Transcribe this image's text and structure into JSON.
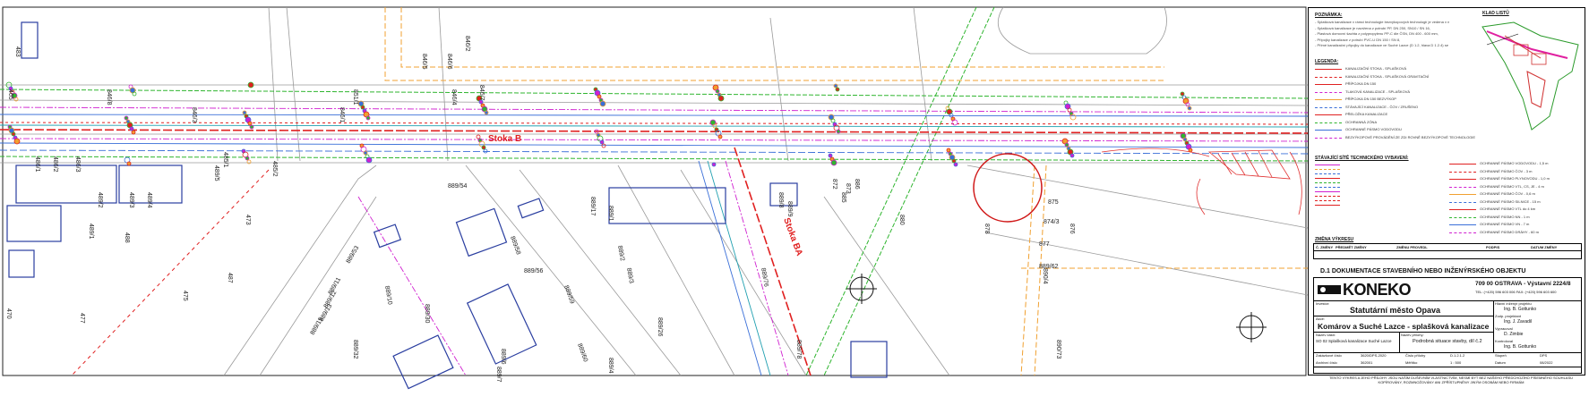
{
  "map": {
    "sewer_labels": [
      "Stoka B",
      "Stoka BA"
    ],
    "parcel_labels": [
      {
        "text": "846/5"
      },
      {
        "text": "846/6"
      },
      {
        "text": "846/7"
      },
      {
        "text": "846/4"
      },
      {
        "text": "846/8"
      },
      {
        "text": "846/3"
      },
      {
        "text": "846/1"
      },
      {
        "text": "489/5"
      },
      {
        "text": "489/4"
      },
      {
        "text": "489/3"
      },
      {
        "text": "489/2"
      },
      {
        "text": "489/1"
      },
      {
        "text": "486/3"
      },
      {
        "text": "486/2"
      },
      {
        "text": "486/1"
      },
      {
        "text": "485/1"
      },
      {
        "text": "485/2"
      },
      {
        "text": "488"
      },
      {
        "text": "487"
      },
      {
        "text": "473"
      },
      {
        "text": "475"
      },
      {
        "text": "477"
      },
      {
        "text": "470"
      },
      {
        "text": "483"
      },
      {
        "text": "465"
      },
      {
        "text": "889/54"
      },
      {
        "text": "889/53"
      },
      {
        "text": "889/56"
      },
      {
        "text": "889/58"
      },
      {
        "text": "889/59"
      },
      {
        "text": "889/60"
      },
      {
        "text": "889/17"
      },
      {
        "text": "889/26"
      },
      {
        "text": "889/30"
      },
      {
        "text": "889/32"
      },
      {
        "text": "889/10"
      },
      {
        "text": "889/11"
      },
      {
        "text": "889/12"
      },
      {
        "text": "889/13"
      },
      {
        "text": "889/15"
      },
      {
        "text": "889/1"
      },
      {
        "text": "889/2"
      },
      {
        "text": "889/3"
      },
      {
        "text": "889/4"
      },
      {
        "text": "889/6"
      },
      {
        "text": "889/7"
      },
      {
        "text": "889/76"
      },
      {
        "text": "889/78"
      },
      {
        "text": "889/8"
      },
      {
        "text": "889/9"
      },
      {
        "text": "889/62"
      },
      {
        "text": "890/4"
      },
      {
        "text": "890/73"
      },
      {
        "text": "874/3"
      },
      {
        "text": "877"
      },
      {
        "text": "875"
      },
      {
        "text": "876"
      },
      {
        "text": "878"
      },
      {
        "text": "880"
      },
      {
        "text": "885"
      },
      {
        "text": "886"
      },
      {
        "text": "851/1"
      },
      {
        "text": "846/2"
      },
      {
        "text": "872"
      },
      {
        "text": "873"
      }
    ]
  },
  "sheet": {
    "notes_title": "POZNÁMKA:",
    "notes": [
      "- Splašková kanalizace v rámci technologie bezvýkopových technologií je vedena v nejmenší hloubce pod terénem,",
      "- Splašková kanalizace je navržena z potrubí PP, DN 250, SN10 / SN 16,",
      "- Plastová domovní šachta z polypropylenu PP-C dle ČSN, DN 400 - 600 mm,",
      "- Přípojky kanalizace z potrubí PVC-U DN 150 / SN 8,",
      "- Přímé kanalizační přípojky do kanalizace ve Suché Lazce (D 1.2, hlava D 1.2.4) se nahrazují PVC-U DN 150"
    ],
    "legend_title": "LEGENDA:",
    "legend_left": [
      "KANALIZAČNÍ STOKA - SPLAŠKOVÁ",
      "KANALIZAČNÍ STOKA - SPLAŠKOVÁ GRAVITAČNÍ",
      "PŘÍPOJKA DN 150",
      "TLAKOVÁ KANALIZACE - SPLAŠKOVÁ",
      "PŘÍPOJKA DN 150 BEZVÝKOP",
      "STÁVAJÍCÍ KANALIZACE - ČOV / ZRUŠENO",
      "PŘELOŽKA KANALIZACE",
      "OCHRANNÁ ZÓNA",
      "OCHRANNÉ PÁSMO VODOVODU",
      "BEZVÝKOPOVÉ PROVÁDĚNÍ ZE ZDI ROVNĚ BEZVÝKOPOVÉ TECHNOLOGIE"
    ],
    "legend_right": [
      "OCHRANNÉ PÁSMO VODOVODU - 1,5 m",
      "OCHRANNÉ PÁSMO ČOV - 3 m",
      "OCHRANNÉ PÁSMO PLYNOVODU - 1,0 m",
      "OCHRANNÉ PÁSMO VTL, CS, JE - 4 m",
      "OCHRANNÉ PÁSMO ČOV - 0,6 m",
      "OCHRANNÉ PÁSMO SILNICE - 15 m",
      "OCHRANNÉ PÁSMO VTL do 4 km",
      "OCHRANNÉ PÁSMO NN - 1 m",
      "OCHRANNÉ PÁSMO VN - 7 m",
      "OCHRANNÉ PÁSMO DRÁHY - 60 m"
    ],
    "existing_title": "STÁVAJÍCÍ SÍTĚ TECHNICKÉHO VYBAVENÍ:",
    "key_map_title": "KLAD LISTŮ",
    "changes_title": "ZMĚNA VÝKRESU",
    "changes_headers": [
      "Č. ZMĚNY",
      "PŘEDMĚT ZMĚNY",
      "ZMĚNU PROVEDL",
      "PODPIS",
      "DATUM ZMĚNY"
    ],
    "doc_title": "D.1  DOKUMENTACE STAVEBNÍHO NEBO INŽENÝRSKÉHO OBJEKTU",
    "company": "KONEKO",
    "company_address": "709 00 OSTRAVA - Výstavní 2224/8",
    "company_contact": "TEL: (+420) 596 603 006     FAX: (+420) 596 603 600",
    "investor_label": "Investor:",
    "investor": "Statutární město Opava",
    "project_label": "Akce:",
    "project": "Komárov a Suché Lazce - splašková kanalizace",
    "object_label": "Název části:",
    "object": "SO 02 Splašková kanalizace Suché Lazce",
    "drawing_label": "Název přílohy:",
    "drawing": "Podrobná situace stavby, díl č.2",
    "roles": [
      {
        "label": "Hlavní inženýr projektu",
        "name": "Ing. B. Gottunko"
      },
      {
        "label": "Zodp. projektant",
        "name": "Ing. J. Zavadil"
      },
      {
        "label": "Vypracoval",
        "name": "D. Zimbie"
      },
      {
        "label": "Kontroloval",
        "name": "Ing. B. Gottunko"
      }
    ],
    "meta": [
      {
        "label": "Zakázkové číslo",
        "value": "3620/DPS-2020"
      },
      {
        "label": "Číslo přílohy",
        "value": "D.1.2.1.2"
      },
      {
        "label": "Stupeň",
        "value": "DPS"
      },
      {
        "label": "Archivní číslo",
        "value": "362001"
      },
      {
        "label": "Měřítko",
        "value": "1 : 500"
      },
      {
        "label": "Datum",
        "value": "08/2022"
      }
    ],
    "footer": "TENTO VÝKRES A JEHO PŘÍLOHY JSOU NAŠÍM DUŠEVNÍM VLASTNICTVÍM, NESMÍ BÝT BEZ NAŠEHO PŘEDCHOZÍHO PÍSEMNÉHO SOUHLASU KOPÍROVÁNY, ROZMNOŽOVÁNY ANI ZPŘÍSTUPNĚNY JINÝM OSOBÁM NEBO FIRMÁM"
  }
}
